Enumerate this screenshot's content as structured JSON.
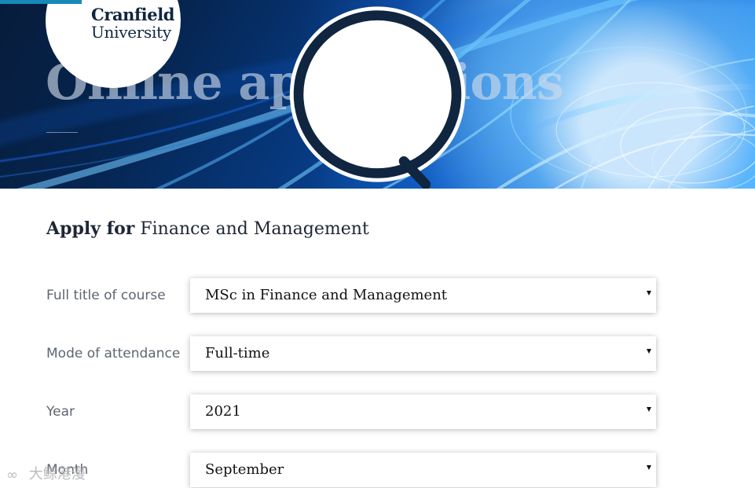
{
  "brand": {
    "line_1": "Cranfield",
    "line_2": "University"
  },
  "hero": {
    "title": "Online applications"
  },
  "apply": {
    "prefix": "Apply for",
    "programme": "Finance and Management"
  },
  "form": {
    "fields": [
      {
        "label": "Full title of course",
        "value": "MSc in Finance and Management"
      },
      {
        "label": "Mode of attendance",
        "value": "Full-time"
      },
      {
        "label": "Year",
        "value": "2021"
      },
      {
        "label": "Month",
        "value": "September"
      }
    ]
  },
  "watermark": {
    "text": "大鲸港漫"
  },
  "colors": {
    "accent": "#1689b8",
    "brand_navy": "#102540",
    "hero_highlight": "#39a6ff"
  },
  "icons": {
    "dropdown": "caret-down-icon",
    "logo_mark": "cranfield-q-logo"
  }
}
